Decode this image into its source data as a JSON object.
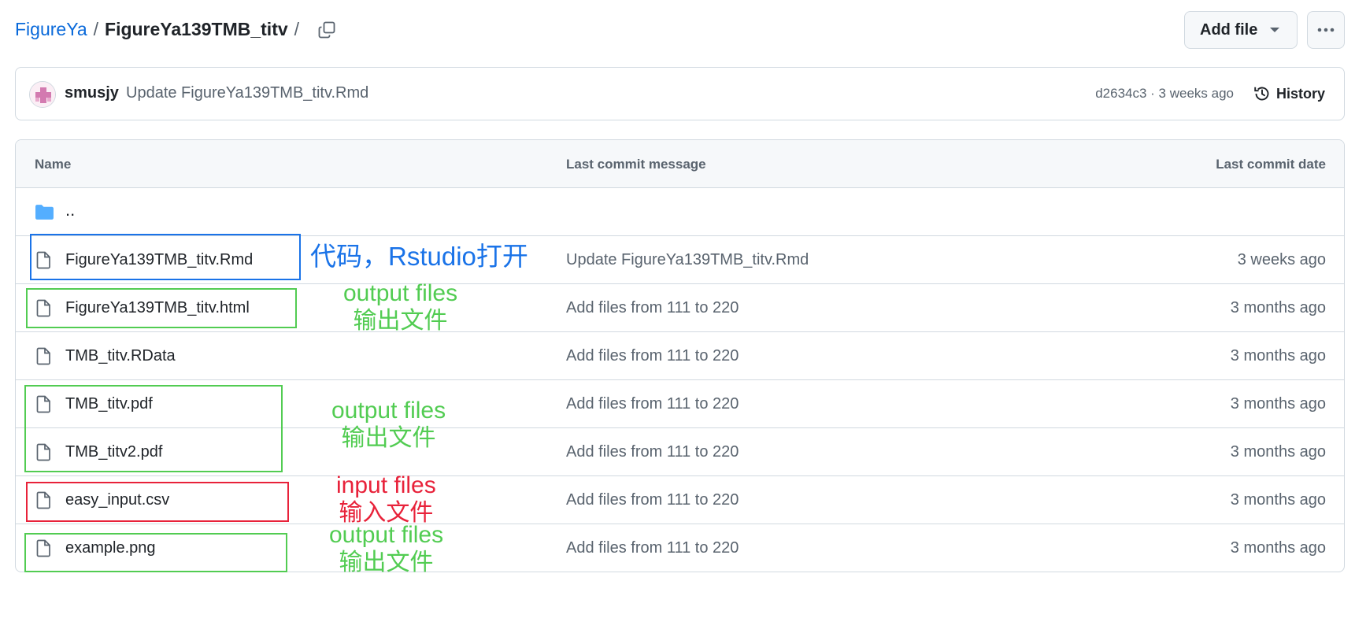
{
  "breadcrumb": {
    "root": "FigureYa",
    "separator": "/",
    "current": "FigureYa139TMB_titv",
    "trailing": "/"
  },
  "toolbar": {
    "add_file_label": "Add file",
    "more_label": "..."
  },
  "commit": {
    "author": "smusjy",
    "message": "Update FigureYa139TMB_titv.Rmd",
    "meta": "d2634c3 · 3 weeks ago",
    "history_label": "History"
  },
  "table": {
    "headers": {
      "name": "Name",
      "message": "Last commit message",
      "date": "Last commit date"
    },
    "parent_link": "..",
    "rows": [
      {
        "name": "FigureYa139TMB_titv.Rmd",
        "message": "Update FigureYa139TMB_titv.Rmd",
        "date": "3 weeks ago"
      },
      {
        "name": "FigureYa139TMB_titv.html",
        "message": "Add files from 111 to 220",
        "date": "3 months ago"
      },
      {
        "name": "TMB_titv.RData",
        "message": "Add files from 111 to 220",
        "date": "3 months ago"
      },
      {
        "name": "TMB_titv.pdf",
        "message": "Add files from 111 to 220",
        "date": "3 months ago"
      },
      {
        "name": "TMB_titv2.pdf",
        "message": "Add files from 111 to 220",
        "date": "3 months ago"
      },
      {
        "name": "easy_input.csv",
        "message": "Add files from 111 to 220",
        "date": "3 months ago"
      },
      {
        "name": "example.png",
        "message": "Add files from 111 to 220",
        "date": "3 months ago"
      }
    ]
  },
  "annotations": {
    "code": "代码，Rstudio打开",
    "output1": {
      "line1": "output files",
      "line2": "输出文件"
    },
    "output2": {
      "line1": "output files",
      "line2": "输出文件"
    },
    "input": {
      "line1": "input files",
      "line2": "输入文件"
    },
    "output3": {
      "line1": "output files",
      "line2": "输出文件"
    }
  },
  "colors": {
    "link_blue": "#0969da",
    "annotation_blue": "#1a73e8",
    "annotation_green": "#52cc52",
    "annotation_red": "#e8223a",
    "folder_blue": "#54aeff",
    "muted_text": "#59636e",
    "border": "#d1d9e0"
  },
  "icons": {
    "copy": "copy-icon",
    "caret": "triangle-down-icon",
    "kebab": "kebab-horizontal-icon",
    "history": "history-icon",
    "folder": "folder-icon",
    "file": "file-icon"
  }
}
